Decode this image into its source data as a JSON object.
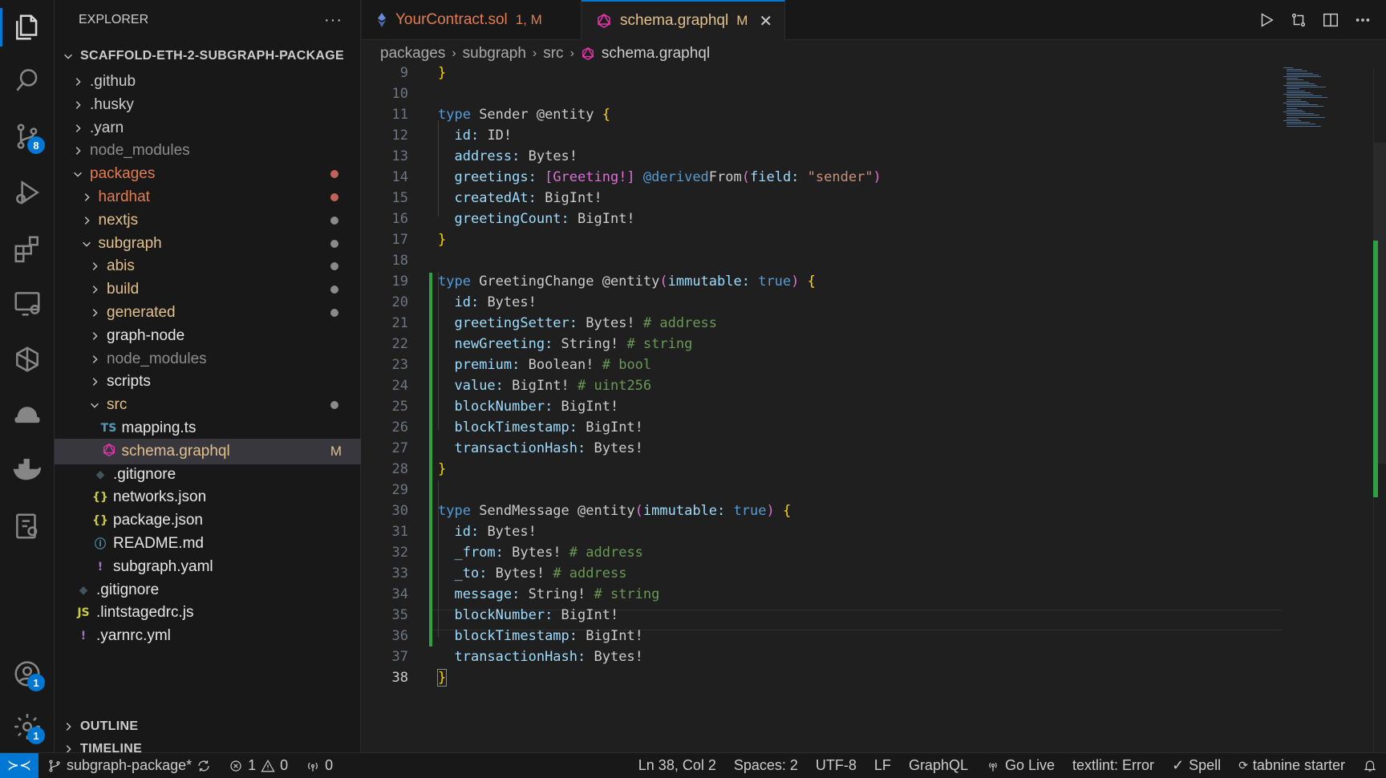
{
  "colors": {
    "accent": "#0078d4",
    "modified": "#e2c08d",
    "conflict": "#e37c52",
    "added_gutter": "#2ea043"
  },
  "activity_bar": {
    "items": [
      {
        "icon": "files-icon",
        "active": true
      },
      {
        "icon": "search-icon"
      },
      {
        "icon": "source-control-icon",
        "badge": "8"
      },
      {
        "icon": "run-debug-icon"
      },
      {
        "icon": "extensions-icon"
      },
      {
        "icon": "remote-explorer-icon"
      },
      {
        "icon": "hardhat-icon"
      },
      {
        "icon": "tabnine-hat-icon"
      },
      {
        "icon": "docker-icon"
      },
      {
        "icon": "gitlens-icon"
      }
    ],
    "account_badge": "1",
    "settings_badge": "1"
  },
  "sidebar": {
    "title": "EXPLORER",
    "more": "···",
    "root": "SCAFFOLD-ETH-2-SUBGRAPH-PACKAGE",
    "items": [
      {
        "label": ".github",
        "kind": "folder-closed",
        "color": "default"
      },
      {
        "label": ".husky",
        "kind": "folder-closed",
        "color": "default"
      },
      {
        "label": ".yarn",
        "kind": "folder-closed",
        "color": "default"
      },
      {
        "label": "node_modules",
        "kind": "folder-closed",
        "color": "dim"
      },
      {
        "label": "packages",
        "kind": "folder-open",
        "color": "orange",
        "dot": "#c1635b"
      },
      {
        "label": "hardhat",
        "kind": "folder-closed",
        "color": "orange",
        "dot": "#c1635b"
      },
      {
        "label": "nextjs",
        "kind": "folder-closed",
        "color": "tan",
        "dot": "#8a8a8a"
      },
      {
        "label": "subgraph",
        "kind": "folder-open",
        "color": "tan",
        "dot": "#8a8a8a"
      },
      {
        "label": "abis",
        "kind": "folder-closed",
        "color": "tan",
        "dot": "#8a8a8a"
      },
      {
        "label": "build",
        "kind": "folder-closed",
        "color": "tan",
        "dot": "#8a8a8a"
      },
      {
        "label": "generated",
        "kind": "folder-closed",
        "color": "tan",
        "dot": "#8a8a8a"
      },
      {
        "label": "graph-node",
        "kind": "folder-closed",
        "color": "bright"
      },
      {
        "label": "node_modules",
        "kind": "folder-closed",
        "color": "dim"
      },
      {
        "label": "scripts",
        "kind": "folder-closed",
        "color": "bright"
      },
      {
        "label": "src",
        "kind": "folder-open",
        "color": "tan",
        "dot": "#8a8a8a"
      },
      {
        "label": "mapping.ts",
        "kind": "file",
        "icon": "TS",
        "iconColor": "#519aba",
        "color": "bright"
      },
      {
        "label": "schema.graphql",
        "kind": "file",
        "icon": "graphql",
        "color": "tan",
        "mod": "M",
        "selected": true
      },
      {
        "label": ".gitignore",
        "kind": "file",
        "icon": "◆",
        "iconColor": "#41535b",
        "color": "bright"
      },
      {
        "label": "networks.json",
        "kind": "file",
        "icon": "{}",
        "iconColor": "#cbcb41",
        "color": "bright"
      },
      {
        "label": "package.json",
        "kind": "file",
        "icon": "{}",
        "iconColor": "#cbcb41",
        "color": "bright"
      },
      {
        "label": "README.md",
        "kind": "file",
        "icon": "ⓘ",
        "iconColor": "#519aba",
        "color": "bright"
      },
      {
        "label": "subgraph.yaml",
        "kind": "file",
        "icon": "!",
        "iconColor": "#a074c4",
        "color": "bright"
      },
      {
        "label": ".gitignore",
        "kind": "file",
        "icon": "◆",
        "iconColor": "#41535b",
        "color": "bright"
      },
      {
        "label": ".lintstagedrc.js",
        "kind": "file",
        "icon": "JS",
        "iconColor": "#cbcb41",
        "color": "bright"
      },
      {
        "label": ".yarnrc.yml",
        "kind": "file",
        "icon": "!",
        "iconColor": "#a074c4",
        "color": "bright"
      }
    ],
    "outline": "OUTLINE",
    "timeline": "TIMELINE"
  },
  "tabs": [
    {
      "label": "YourContract.sol",
      "status": "1, M",
      "active": false
    },
    {
      "label": "schema.graphql",
      "status": "M",
      "active": true
    }
  ],
  "breadcrumbs": [
    "packages",
    "subgraph",
    "src",
    "schema.graphql"
  ],
  "editor": {
    "current_line": 38,
    "lines": [
      {
        "n": "9"
      },
      {
        "n": "10"
      },
      {
        "n": "11"
      },
      {
        "n": "12"
      },
      {
        "n": "13"
      },
      {
        "n": "14"
      },
      {
        "n": "15"
      },
      {
        "n": "16"
      },
      {
        "n": "17"
      },
      {
        "n": "18"
      },
      {
        "n": "19"
      },
      {
        "n": "20"
      },
      {
        "n": "21"
      },
      {
        "n": "22"
      },
      {
        "n": "23"
      },
      {
        "n": "24"
      },
      {
        "n": "25"
      },
      {
        "n": "26"
      },
      {
        "n": "27"
      },
      {
        "n": "28"
      },
      {
        "n": "29"
      },
      {
        "n": "30"
      },
      {
        "n": "31"
      },
      {
        "n": "32"
      },
      {
        "n": "33"
      },
      {
        "n": "34"
      },
      {
        "n": "35"
      },
      {
        "n": "36"
      },
      {
        "n": "37"
      },
      {
        "n": "38"
      }
    ],
    "code": {
      "l9": "}",
      "l11_kw": "type",
      "l11_name": " Sender @entity ",
      "l11_br": "{",
      "l12_f": "id:",
      "l12_t": " ID!",
      "l13_f": "address:",
      "l13_t": " Bytes!",
      "l14_f": "greetings:",
      "l14_a": " [Greeting!] ",
      "l14_d": "@derived",
      "l14_fn": "From",
      "l14_p1": "(",
      "l14_fld": "field:",
      "l14_s": " \"sender\"",
      "l14_p2": ")",
      "l15_f": "createdAt:",
      "l15_t": " BigInt!",
      "l16_f": "greetingCount:",
      "l16_t": " BigInt!",
      "l17": "}",
      "l19_kw": "type",
      "l19_name": " GreetingChange @entity",
      "l19_p1": "(",
      "l19_f": "immutable:",
      "l19_v": " true",
      "l19_p2": ")",
      "l19_br": " {",
      "l20_f": "id:",
      "l20_t": " Bytes!",
      "l21_f": "greetingSetter:",
      "l21_t": " Bytes!",
      "l21_c": " # address",
      "l22_f": "newGreeting:",
      "l22_t": " String!",
      "l22_c": " # string",
      "l23_f": "premium:",
      "l23_t": " Boolean!",
      "l23_c": " # bool",
      "l24_f": "value:",
      "l24_t": " BigInt!",
      "l24_c": " # uint256",
      "l25_f": "blockNumber:",
      "l25_t": " BigInt!",
      "l26_f": "blockTimestamp:",
      "l26_t": " BigInt!",
      "l27_f": "transactionHash:",
      "l27_t": " Bytes!",
      "l28": "}",
      "l30_kw": "type",
      "l30_name": " SendMessage @entity",
      "l30_p1": "(",
      "l30_f": "immutable:",
      "l30_v": " true",
      "l30_p2": ")",
      "l30_br": " {",
      "l31_f": "id:",
      "l31_t": " Bytes!",
      "l32_f": "_from:",
      "l32_t": " Bytes!",
      "l32_c": " # address",
      "l33_f": "_to:",
      "l33_t": " Bytes!",
      "l33_c": " # address",
      "l34_f": "message:",
      "l34_t": " String!",
      "l34_c": " # string",
      "l35_f": "blockNumber:",
      "l35_t": " BigInt!",
      "l36_f": "blockTimestamp:",
      "l36_t": " BigInt!",
      "l37_f": "transactionHash:",
      "l37_t": " Bytes!",
      "l38": "}"
    }
  },
  "statusbar": {
    "branch": "subgraph-package*",
    "errors": "1",
    "warnings": "0",
    "ports": "0",
    "position": "Ln 38, Col 2",
    "spaces": "Spaces: 2",
    "encoding": "UTF-8",
    "eol": "LF",
    "language": "GraphQL",
    "go_live": "Go Live",
    "textlint": "textlint: Error",
    "spell": "Spell",
    "tabnine": "tabnine starter"
  }
}
